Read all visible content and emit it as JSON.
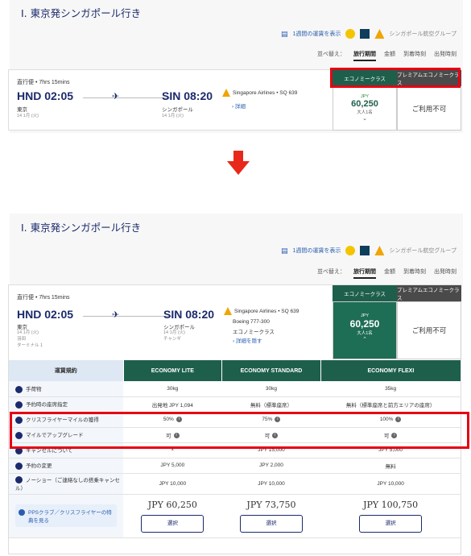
{
  "top": {
    "title": "I. 東京発シンガポール行き",
    "show_week": "1週間の運賃を表示",
    "group": "シンガポール航空グループ",
    "sort_label": "並べ替え：",
    "sort_options": [
      "旅行期間",
      "金額",
      "到着時刻",
      "出発時刻"
    ],
    "flight": {
      "type": "直行便 • 7hrs 15mins",
      "dep_time": "HND 02:05",
      "dep_city": "東京",
      "dep_date": "14 1月 (火)",
      "arr_time": "SIN 08:20",
      "arr_city": "シンガポール",
      "arr_date": "14 1月 (火)",
      "airline": "Singapore Airlines • SQ 639",
      "detail": "› 詳細"
    },
    "eco_header": "エコノミークラス",
    "prem_header": "プレミアムエコノミークラス",
    "fare_cur": "JPY",
    "fare_val": "60,250",
    "fare_pax": "大人1名",
    "unavailable": "ご利用不可"
  },
  "bottom": {
    "title": "I. 東京発シンガポール行き",
    "show_week": "1週間の運賃を表示",
    "group": "シンガポール航空グループ",
    "sort_label": "並べ替え：",
    "sort_options": [
      "旅行期間",
      "金額",
      "到着時刻",
      "出発時刻"
    ],
    "flight": {
      "type": "直行便 • 7hrs 15mins",
      "dep_time": "HND 02:05",
      "dep_city": "東京",
      "dep_date": "14 1月 (火)",
      "dep_airport": "羽田",
      "dep_terminal": "ターミナル 1",
      "arr_time": "SIN 08:20",
      "arr_city": "シンガポール",
      "arr_date": "14 1月 (火)",
      "arr_airport": "チャンギ",
      "airline": "Singapore Airlines • SQ 639",
      "aircraft": "Boeing 777-300",
      "cabin": "エコノミークラス",
      "detail": "› 詳細を隠す"
    },
    "eco_header": "エコノミークラス",
    "prem_header": "プレミアムエコノミークラス",
    "fare_cur": "JPY",
    "fare_val": "60,250",
    "fare_pax": "大人1名",
    "unavailable": "ご利用不可",
    "rules_header": "運賃規約",
    "fare_types": [
      "ECONOMY LITE",
      "ECONOMY STANDARD",
      "ECONOMY FLEXI"
    ],
    "rows": [
      {
        "label": "手荷物",
        "values": [
          "30kg",
          "30kg",
          "35kg"
        ]
      },
      {
        "label": "予約時の座席指定",
        "values": [
          "出発地 JPY 1,094",
          "無料（標準座席）",
          "無料（標準座席と前方エリアの座席）"
        ]
      },
      {
        "label": "クリスフライヤーマイルの獲得",
        "values": [
          "50%",
          "75%",
          "100%"
        ]
      },
      {
        "label": "マイルでアップグレード",
        "values": [
          "可",
          "可",
          "可"
        ]
      },
      {
        "label": "キャンセルについて",
        "values": [
          "×",
          "JPY 15,000",
          "JPY 5,000"
        ]
      },
      {
        "label": "予約の変更",
        "values": [
          "JPY 5,000",
          "JPY 2,000",
          "無料"
        ]
      },
      {
        "label": "ノーショー（ご連絡なしの搭乗キャンセル）",
        "values": [
          "JPY 10,000",
          "JPY 10,000",
          "JPY 10,000"
        ]
      }
    ],
    "pps": "PPSクラブ／クリスフライヤーの特典を見る",
    "prices": [
      "JPY 60,250",
      "JPY 73,750",
      "JPY 100,750"
    ],
    "select": "選択"
  },
  "colors": {
    "navy": "#1b2a6b",
    "eco_green": "#1e5f4c",
    "highlight_red": "#e60012",
    "link_blue": "#2a5db0"
  }
}
